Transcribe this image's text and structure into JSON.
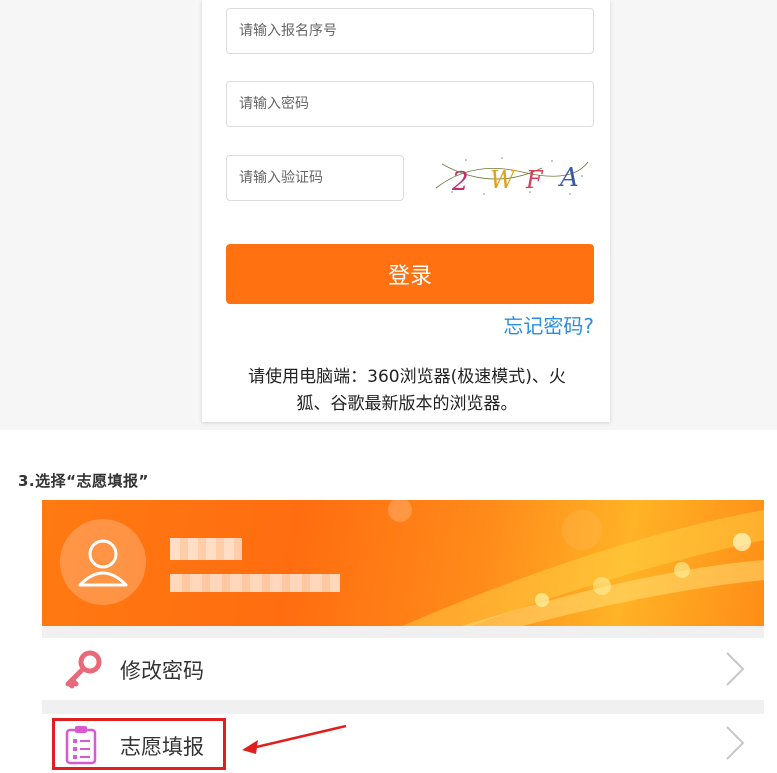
{
  "login": {
    "reg_number_placeholder": "请输入报名序号",
    "password_placeholder": "请输入密码",
    "captcha_placeholder": "请输入验证码",
    "captcha_text": [
      "2",
      "W",
      "F",
      "A"
    ],
    "login_label": "登录",
    "forgot_label": "忘记密码?",
    "browser_tip_line1": "请使用电脑端：360浏览器(极速模式)、火",
    "browser_tip_line2": "狐、谷歌最新版本的浏览器。"
  },
  "step": {
    "text": "3.选择“志愿填报”"
  },
  "menu": {
    "items": [
      {
        "label": "修改密码",
        "icon": "key-icon"
      },
      {
        "label": "志愿填报",
        "icon": "clipboard-icon"
      }
    ]
  },
  "colors": {
    "accent_orange": "#ff7111",
    "link_blue": "#2b8fe0",
    "highlight_red": "#e02020"
  }
}
